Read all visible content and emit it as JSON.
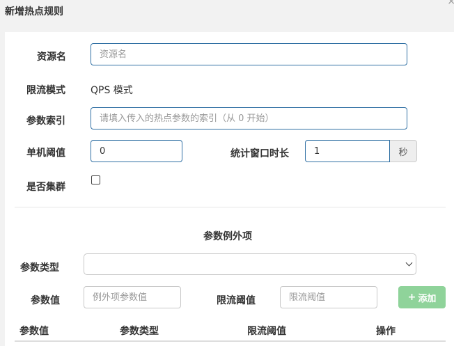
{
  "dialog": {
    "title": "新增热点规则",
    "close_glyph": "×"
  },
  "form": {
    "resource_label": "资源名",
    "resource_placeholder": "资源名",
    "grade_label": "限流模式",
    "grade_value": "QPS 模式",
    "param_idx_label": "参数索引",
    "param_idx_placeholder": "请填入传入的热点参数的索引（从 0 开始）",
    "threshold_label": "单机阈值",
    "threshold_value": "0",
    "window_label": "统计窗口时长",
    "window_value": "1",
    "window_unit": "秒",
    "cluster_label": "是否集群",
    "cluster_checked": false
  },
  "exceptions": {
    "section_title": "参数例外项",
    "type_label": "参数类型",
    "type_selected": "",
    "value_label": "参数值",
    "value_placeholder": "例外项参数值",
    "limit_label": "限流阈值",
    "limit_placeholder": "限流阈值",
    "add_icon": "plus-icon",
    "add_label": "添加"
  },
  "table": {
    "columns": [
      "参数值",
      "参数类型",
      "限流阈值",
      "操作"
    ],
    "rows": []
  },
  "colors": {
    "focus_border": "#2f6fa3",
    "add_button": "#8fd39a"
  }
}
